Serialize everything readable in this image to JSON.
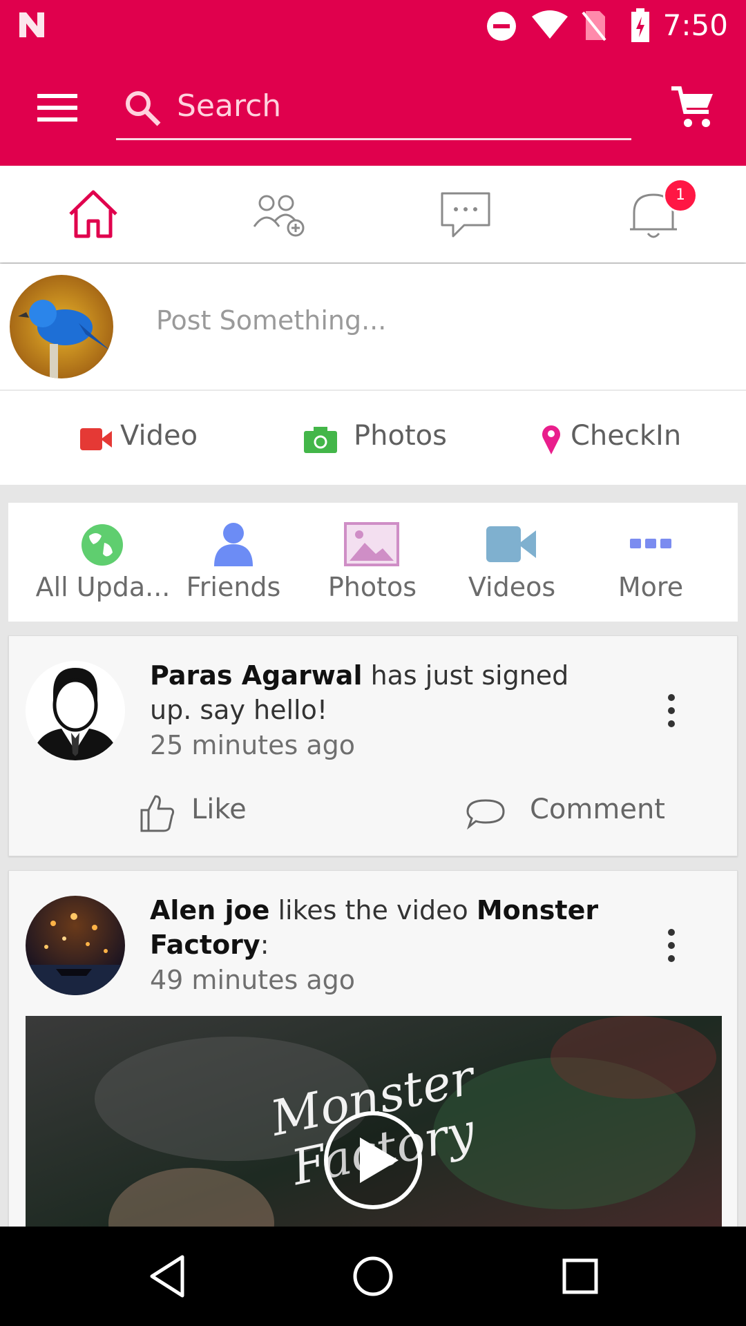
{
  "status_bar": {
    "time": "7:50",
    "icons": [
      "n-logo-icon",
      "do-not-disturb-icon",
      "wifi-icon",
      "no-sim-icon",
      "battery-charging-icon"
    ]
  },
  "app_bar": {
    "search_placeholder": "Search",
    "colors": {
      "primary": "#e0004d"
    }
  },
  "tabs": [
    {
      "icon": "home-icon",
      "active": true
    },
    {
      "icon": "friends-add-icon",
      "active": false
    },
    {
      "icon": "messages-icon",
      "active": false
    },
    {
      "icon": "notifications-icon",
      "active": false,
      "badge": "1"
    }
  ],
  "composer": {
    "placeholder": "Post Something...",
    "actions": [
      {
        "label": "Video",
        "icon": "video-camera-icon",
        "color": "#e53935"
      },
      {
        "label": "Photos",
        "icon": "camera-icon",
        "color": "#43b649"
      },
      {
        "label": "CheckIn",
        "icon": "location-pin-icon",
        "color": "#e91e8c"
      }
    ]
  },
  "filters": [
    {
      "label": "All Upda...",
      "icon": "globe-icon",
      "color": "#5fce6f"
    },
    {
      "label": "Friends",
      "icon": "person-icon",
      "color": "#6c8cf5"
    },
    {
      "label": "Photos",
      "icon": "image-icon",
      "color": "#cf8ec6"
    },
    {
      "label": "Videos",
      "icon": "video-icon",
      "color": "#7fb0cf"
    },
    {
      "label": "More",
      "icon": "more-icon",
      "color": "#7b8cf0"
    }
  ],
  "feed": [
    {
      "user": "Paras Agarwal",
      "text_after": " has just signed up. say hello!",
      "time": "25 minutes ago",
      "like_label": "Like",
      "comment_label": "Comment"
    },
    {
      "user": "Alen joe",
      "text_middle": " likes the video ",
      "video_title": "Monster Factory",
      "text_end": ":",
      "time": "49 minutes ago",
      "thumbnail_text": "Monster Factory"
    }
  ]
}
